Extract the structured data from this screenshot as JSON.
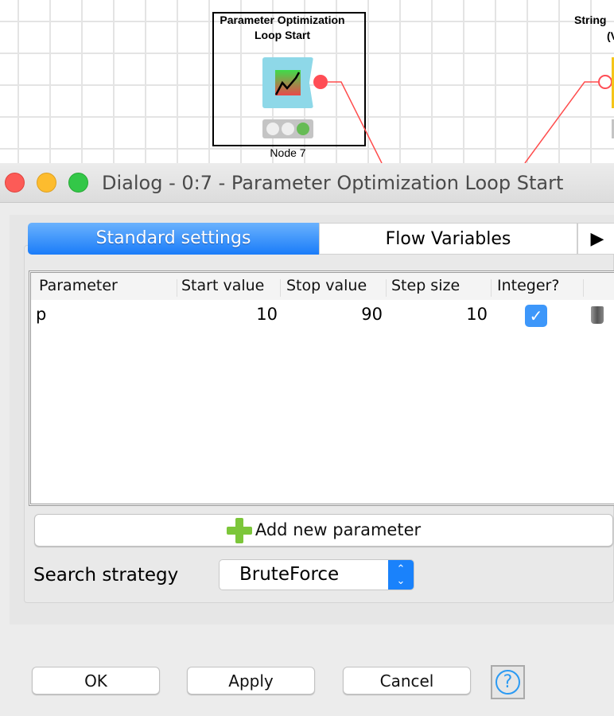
{
  "canvas": {
    "node": {
      "title_line1": "Parameter Optimization",
      "title_line2": "Loop Start",
      "label": "Node 7",
      "status": "executed",
      "status_color": "#66bb55"
    },
    "other_node": {
      "title_line1": "String",
      "title_line2": "(V"
    },
    "connection_color": "#ff4d4d"
  },
  "dialog": {
    "title": "Dialog - 0:7 - Parameter Optimization Loop Start",
    "tabs": [
      {
        "label": "Standard settings",
        "active": true
      },
      {
        "label": "Flow Variables",
        "active": false
      }
    ],
    "tab_scroll_icon": "triangle-right-icon",
    "table": {
      "columns": [
        "Parameter",
        "Start value",
        "Stop value",
        "Step size",
        "Integer?",
        ""
      ],
      "rows": [
        {
          "parameter": "p",
          "start": "10",
          "stop": "90",
          "step": "10",
          "integer": true
        }
      ]
    },
    "add_button": "Add new parameter",
    "search_strategy_label": "Search strategy",
    "search_strategy_value": "BruteForce",
    "buttons": {
      "ok": "OK",
      "apply": "Apply",
      "cancel": "Cancel"
    },
    "accent": "#1a82fb"
  }
}
